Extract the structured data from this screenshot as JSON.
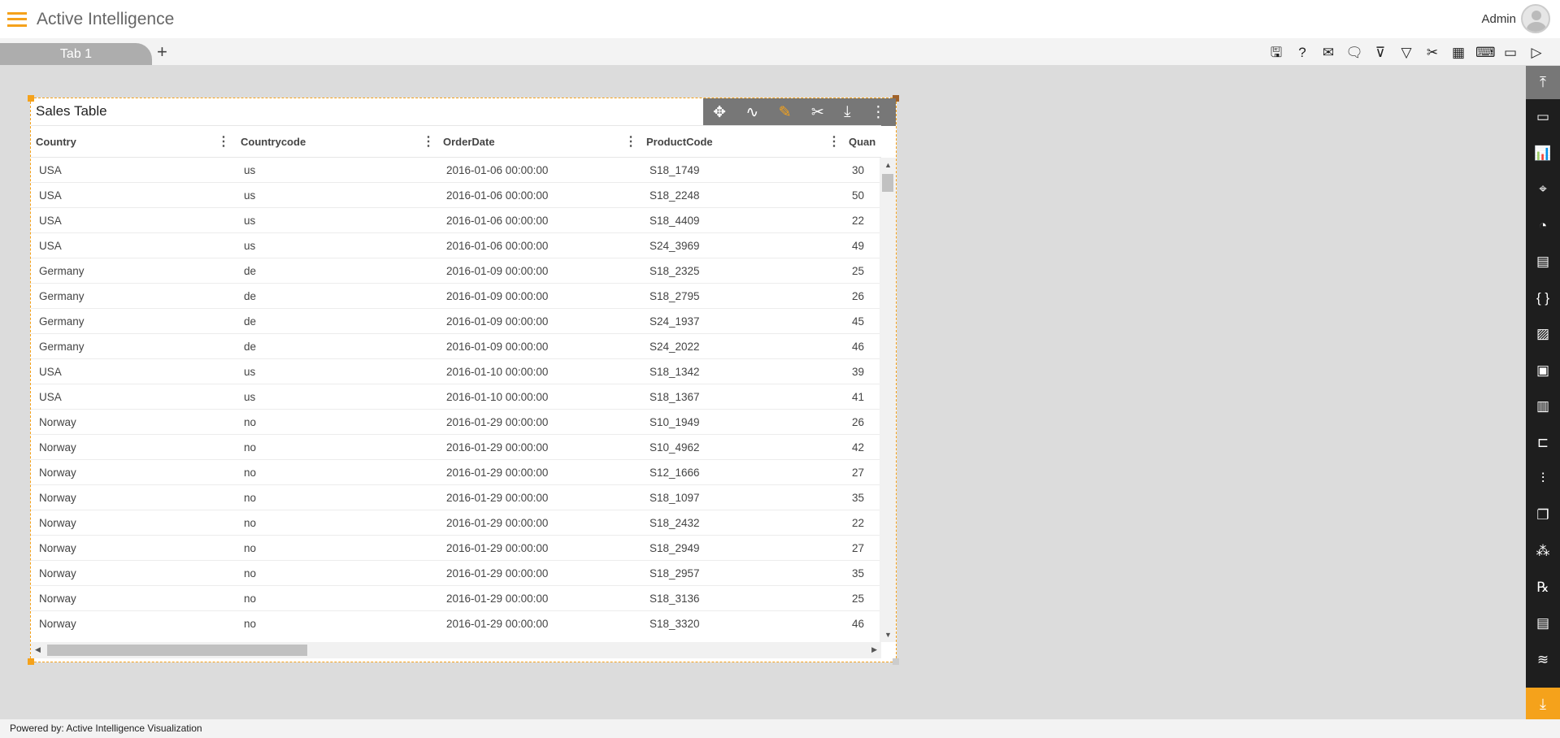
{
  "header": {
    "app_title": "Active Intelligence",
    "user": "Admin"
  },
  "tabs": [
    {
      "label": "Tab 1"
    }
  ],
  "toolbar": {
    "icons": [
      "save-icon",
      "help-icon",
      "mail-icon",
      "comment-icon",
      "clear-filter-icon",
      "filter-icon",
      "tools-icon",
      "table-icon",
      "embed-icon",
      "devices-icon",
      "play-icon"
    ]
  },
  "widget": {
    "title": "Sales Table",
    "columns": [
      "Country",
      "Countrycode",
      "OrderDate",
      "ProductCode",
      "Quan"
    ],
    "rows": [
      [
        "USA",
        "us",
        "2016-01-06 00:00:00",
        "S18_1749",
        "30"
      ],
      [
        "USA",
        "us",
        "2016-01-06 00:00:00",
        "S18_2248",
        "50"
      ],
      [
        "USA",
        "us",
        "2016-01-06 00:00:00",
        "S18_4409",
        "22"
      ],
      [
        "USA",
        "us",
        "2016-01-06 00:00:00",
        "S24_3969",
        "49"
      ],
      [
        "Germany",
        "de",
        "2016-01-09 00:00:00",
        "S18_2325",
        "25"
      ],
      [
        "Germany",
        "de",
        "2016-01-09 00:00:00",
        "S18_2795",
        "26"
      ],
      [
        "Germany",
        "de",
        "2016-01-09 00:00:00",
        "S24_1937",
        "45"
      ],
      [
        "Germany",
        "de",
        "2016-01-09 00:00:00",
        "S24_2022",
        "46"
      ],
      [
        "USA",
        "us",
        "2016-01-10 00:00:00",
        "S18_1342",
        "39"
      ],
      [
        "USA",
        "us",
        "2016-01-10 00:00:00",
        "S18_1367",
        "41"
      ],
      [
        "Norway",
        "no",
        "2016-01-29 00:00:00",
        "S10_1949",
        "26"
      ],
      [
        "Norway",
        "no",
        "2016-01-29 00:00:00",
        "S10_4962",
        "42"
      ],
      [
        "Norway",
        "no",
        "2016-01-29 00:00:00",
        "S12_1666",
        "27"
      ],
      [
        "Norway",
        "no",
        "2016-01-29 00:00:00",
        "S18_1097",
        "35"
      ],
      [
        "Norway",
        "no",
        "2016-01-29 00:00:00",
        "S18_2432",
        "22"
      ],
      [
        "Norway",
        "no",
        "2016-01-29 00:00:00",
        "S18_2949",
        "27"
      ],
      [
        "Norway",
        "no",
        "2016-01-29 00:00:00",
        "S18_2957",
        "35"
      ],
      [
        "Norway",
        "no",
        "2016-01-29 00:00:00",
        "S18_3136",
        "25"
      ],
      [
        "Norway",
        "no",
        "2016-01-29 00:00:00",
        "S18_3320",
        "46"
      ]
    ]
  },
  "footer": {
    "text": "Powered by: Active Intelligence Visualization"
  },
  "colors": {
    "accent": "#f5a21b",
    "sidebar": "#1e1e1e"
  }
}
